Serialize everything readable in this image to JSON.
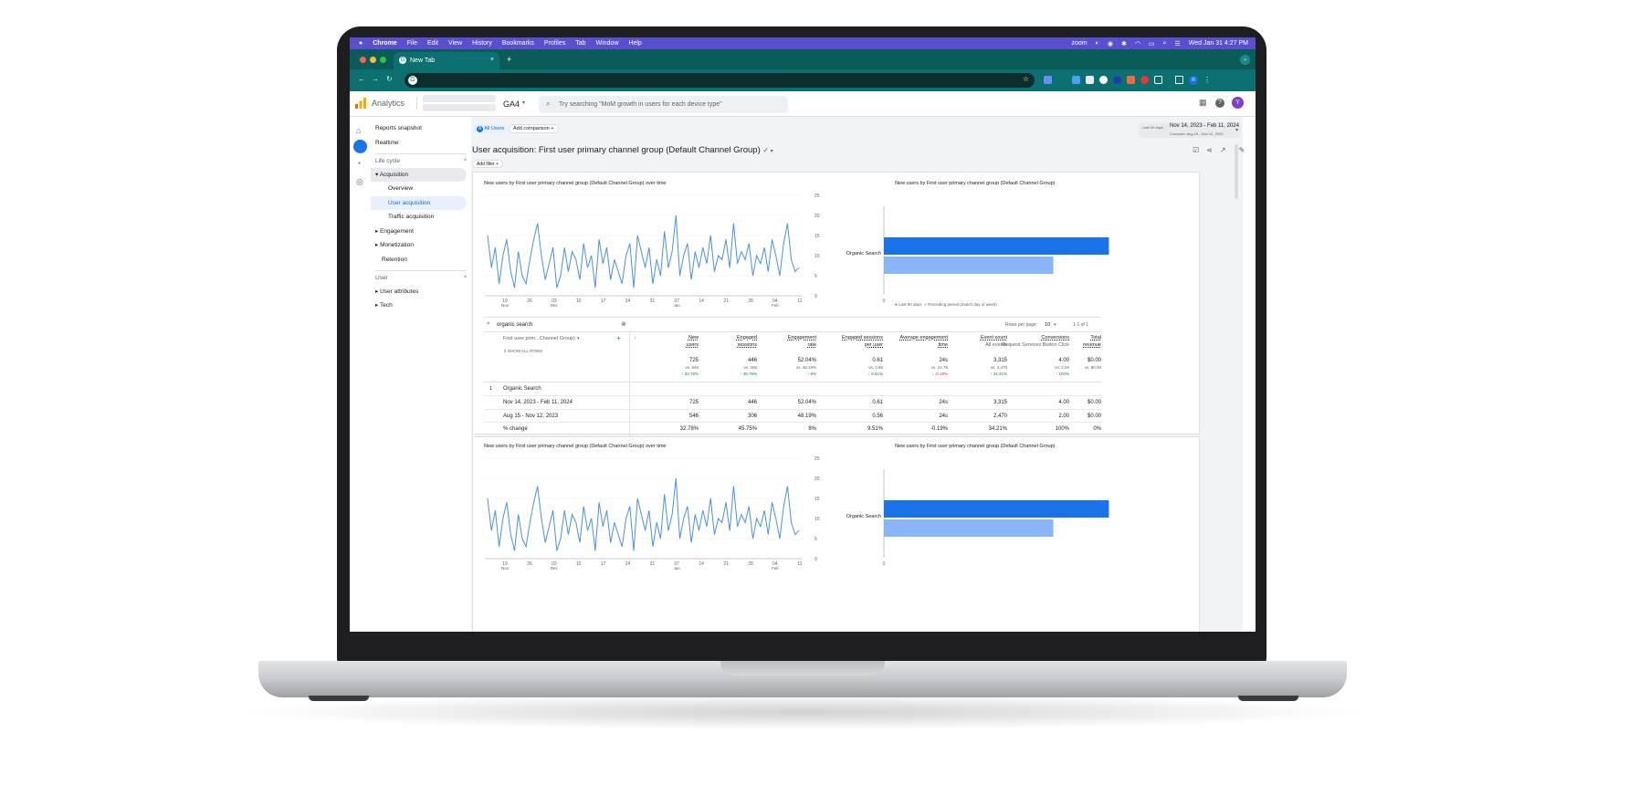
{
  "menubar": {
    "app": "Chrome",
    "items": [
      "File",
      "Edit",
      "View",
      "History",
      "Bookmarks",
      "Profiles",
      "Tab",
      "Window",
      "Help"
    ],
    "zoom_label": "zoom",
    "clock": "Wed Jan 31  4:27 PM"
  },
  "browser": {
    "tab_title": "New Tab",
    "new_tab": "+",
    "profile_initial": "R"
  },
  "ga": {
    "product": "Analytics",
    "property": "GA4",
    "search_placeholder": "Try searching \"MoM growth in users for each device type\"",
    "avatar_initial": "Y"
  },
  "nav": {
    "reports_snapshot": "Reports snapshot",
    "realtime": "Realtime",
    "life_cycle": "Life cycle",
    "acquisition": "Acquisition",
    "overview": "Overview",
    "user_acquisition": "User acquisition",
    "traffic_acquisition": "Traffic acquisition",
    "engagement": "Engagement",
    "monetization": "Monetization",
    "retention": "Retention",
    "user": "User",
    "user_attributes": "User attributes",
    "tech": "Tech"
  },
  "report": {
    "segment_letter": "A",
    "segment": "All Users",
    "add_comparison": "Add comparison",
    "date_label": "Last 90 days",
    "date_range": "Nov 14, 2023 - Feb 11, 2024",
    "compare_range": "Compare: Aug 15 - Nov 12, 2023",
    "title": "User acquisition: First user primary channel group (Default Channel Group)",
    "add_filter": "Add filter"
  },
  "colors": {
    "primary": "#1a73e8",
    "bar_current": "#1a73e8",
    "bar_previous": "#8ab4f8",
    "line": "#4a90e2"
  },
  "chart_data": [
    {
      "type": "line",
      "title": "New users by First user primary channel group (Default Channel Group) over time",
      "x_ticks": [
        "19 Nov",
        "26",
        "03 Dec",
        "10",
        "17",
        "24",
        "31",
        "07 Jan",
        "14",
        "21",
        "28",
        "04 Feb",
        "11"
      ],
      "ylim": [
        0,
        25
      ],
      "y_ticks": [
        "0",
        "5",
        "10",
        "15",
        "20",
        "25"
      ],
      "values": [
        15,
        7,
        12,
        3,
        10,
        14,
        6,
        2,
        11,
        5,
        3,
        9,
        14,
        18,
        10,
        4,
        8,
        12,
        2,
        5,
        12,
        6,
        11,
        9,
        4,
        13,
        7,
        10,
        2,
        14,
        8,
        12,
        4,
        9,
        6,
        3,
        10,
        13,
        2,
        15,
        11,
        7,
        12,
        3,
        9,
        5,
        16,
        7,
        11,
        20,
        5,
        10,
        13,
        4,
        11,
        7,
        12,
        8,
        15,
        6,
        10,
        9,
        14,
        7,
        18,
        8,
        11,
        9,
        13,
        5,
        10,
        8,
        12,
        6,
        14,
        10,
        5,
        13,
        18,
        9,
        6,
        7
      ],
      "x_range": [
        "Nov 14, 2023",
        "Feb 11, 2024"
      ]
    },
    {
      "type": "bar",
      "title": "New users by First user primary channel group (Default Channel Group)",
      "categories": [
        "Organic Search"
      ],
      "series": [
        {
          "name": "Last 90 days",
          "values": [
            725
          ]
        },
        {
          "name": "Preceding period (match day of week)",
          "values": [
            546
          ]
        }
      ],
      "x_ticks": [
        "0"
      ]
    }
  ],
  "table": {
    "search_value": "organic search",
    "rows_per_page_label": "Rows per page:",
    "rows_per_page": "10",
    "pagination": "1-1 of 1",
    "dimension": "First user prim...Channel Group)",
    "show_all_rows": "SHOW ALL ROWS",
    "columns": [
      {
        "l1": "New",
        "l2": "users",
        "sub": ""
      },
      {
        "l1": "Engaged",
        "l2": "sessions",
        "sub": ""
      },
      {
        "l1": "Engagement",
        "l2": "rate",
        "sub": ""
      },
      {
        "l1": "Engaged sessions",
        "l2": "per user",
        "sub": ""
      },
      {
        "l1": "Average engagement",
        "l2": "time",
        "sub": ""
      },
      {
        "l1": "Event count",
        "l2": "All events",
        "sub": ""
      },
      {
        "l1": "Conversions",
        "l2": "Request Services Button Click",
        "sub": ""
      },
      {
        "l1": "Total",
        "l2": "revenue",
        "sub": ""
      }
    ],
    "totals": [
      "725",
      "446",
      "52.04%",
      "0.61",
      "24s",
      "3,315",
      "4.00",
      "$0.00"
    ],
    "totals_vs": [
      "vs. 546",
      "vs. 306",
      "vs. 48.19%",
      "vs. 0.56",
      "vs. 24.75",
      "vs. 2,470",
      "vs. 2.00",
      "vs. $0.00"
    ],
    "totals_change": [
      "↑ 32.78%",
      "↑ 45.75%",
      "↑ 8%",
      "↑ 9.51%",
      "↓ -0.19%",
      "↑ 34.21%",
      "↑ 100%",
      ""
    ],
    "group_index": "1",
    "group_name": "Organic Search",
    "rows": [
      {
        "label": "Nov 14, 2023 - Feb 11, 2024",
        "values": [
          "725",
          "446",
          "52.04%",
          "0.61",
          "24s",
          "3,315",
          "4.00",
          "$0.00"
        ]
      },
      {
        "label": "Aug 15 - Nov 12, 2023",
        "values": [
          "546",
          "306",
          "48.19%",
          "0.56",
          "24s",
          "2,470",
          "2.00",
          "$0.00"
        ]
      },
      {
        "label": "% change",
        "values": [
          "32.78%",
          "45.75%",
          "8%",
          "9.51%",
          "-0.19%",
          "34.21%",
          "100%",
          "0%"
        ]
      }
    ]
  }
}
